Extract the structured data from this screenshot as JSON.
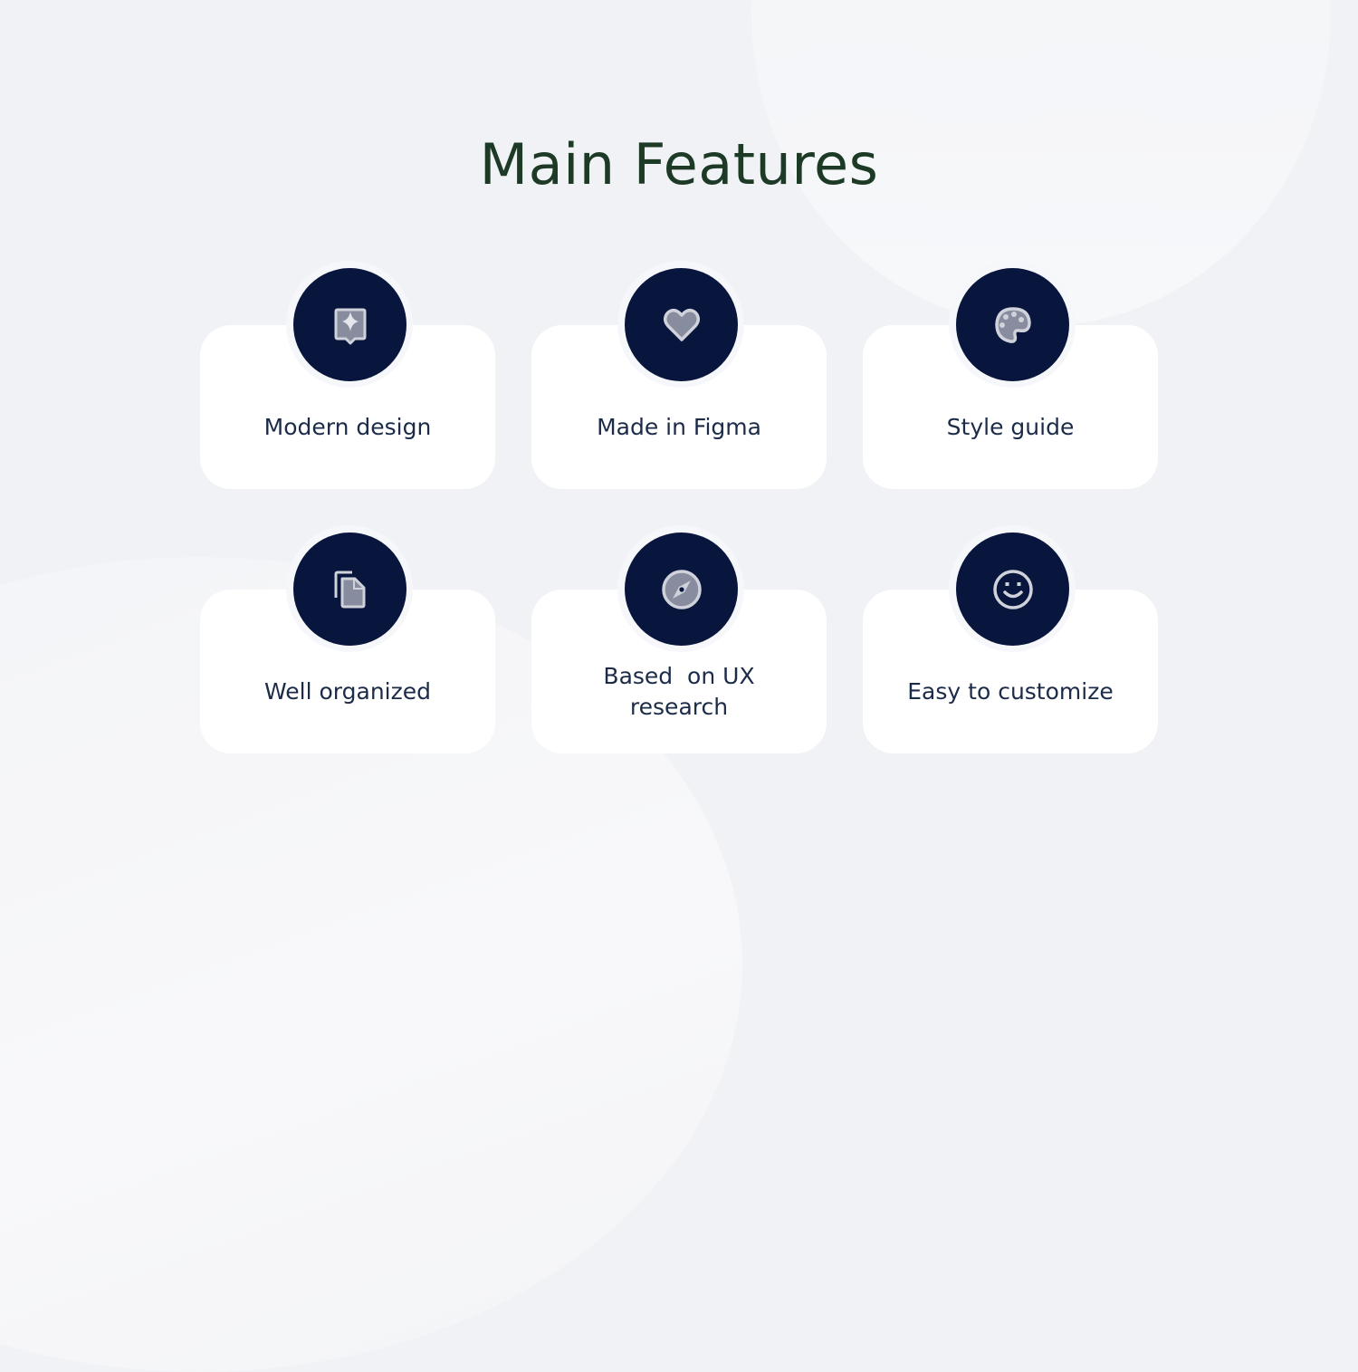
{
  "page": {
    "title": "Main Features"
  },
  "colors": {
    "background": "#f1f2f6",
    "title": "#1d3a26",
    "card": "#ffffff",
    "icon_circle": "#08153c",
    "icon_fill": "#878c9e",
    "icon_stroke": "#cfd2da",
    "label": "#1b2b48"
  },
  "features": [
    {
      "label": "Modern design",
      "icon": "sparkle-badge-icon"
    },
    {
      "label": "Made in Figma",
      "icon": "heart-icon"
    },
    {
      "label": "Style guide",
      "icon": "palette-icon"
    },
    {
      "label": "Well organized",
      "icon": "copy-documents-icon"
    },
    {
      "label": "Based  on UX research",
      "label_line1": "Based  on UX",
      "label_line2": "research",
      "icon": "compass-icon"
    },
    {
      "label": "Easy to customize",
      "icon": "smiley-icon"
    }
  ]
}
